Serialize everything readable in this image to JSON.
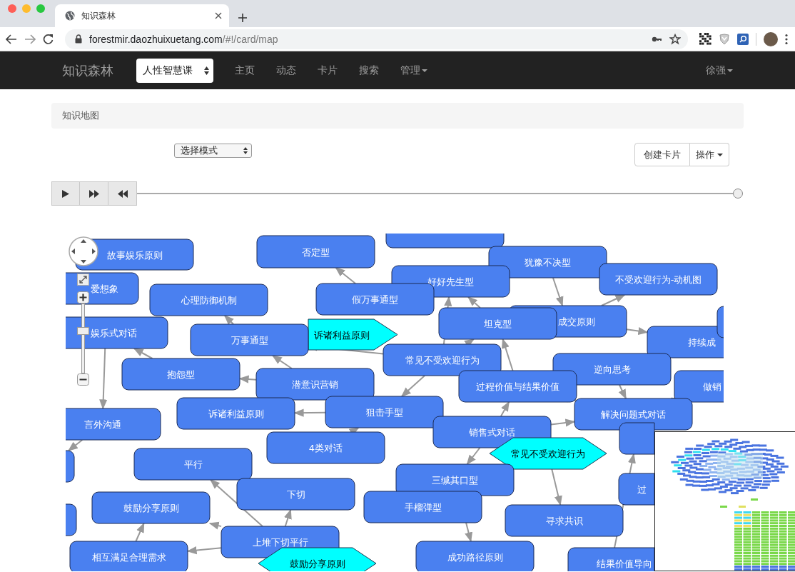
{
  "browser": {
    "tab": {
      "title": "知识森林"
    },
    "url": {
      "host": "forestmir.daozhuixuetang.com",
      "path": "/#!/card/map"
    }
  },
  "navbar": {
    "brand": "知识森林",
    "course_select": {
      "value": "人性智慧课"
    },
    "links": [
      {
        "label": "主页",
        "dropdown": false
      },
      {
        "label": "动态",
        "dropdown": false
      },
      {
        "label": "卡片",
        "dropdown": false
      },
      {
        "label": "搜索",
        "dropdown": false
      },
      {
        "label": "管理",
        "dropdown": true
      }
    ],
    "user": {
      "label": "徐强",
      "dropdown": true
    }
  },
  "breadcrumb": "知识地图",
  "mode_select": {
    "value": "选择模式"
  },
  "buttons": [
    {
      "label": "创建卡片",
      "dropdown": false
    },
    {
      "label": "操作",
      "dropdown": true
    }
  ],
  "timeline": {
    "level": 1
  },
  "map": {
    "zoom": {
      "level": 0.6
    },
    "nodes": [
      {
        "kind": "box",
        "label": "故事娱乐原则"
      },
      {
        "kind": "box",
        "label": "爱想象"
      },
      {
        "kind": "box",
        "label": "否定型"
      },
      {
        "kind": "box"
      },
      {
        "kind": "box",
        "label": "犹豫不决型"
      },
      {
        "kind": "box",
        "label": "好好先生型"
      },
      {
        "kind": "box",
        "label": "不受欢迎行为-动机图"
      },
      {
        "kind": "box",
        "label": "心理防御机制"
      },
      {
        "kind": "box",
        "label": "假万事通型"
      },
      {
        "kind": "box",
        "label": "成交原则"
      },
      {
        "kind": "box",
        "label": "坦克型"
      },
      {
        "kind": "box",
        "label": "娱乐式对话"
      },
      {
        "kind": "hexagon",
        "label": "诉诸利益原则"
      },
      {
        "kind": "box",
        "label": "万事通型"
      },
      {
        "kind": "box",
        "label": "持续成"
      },
      {
        "kind": "box"
      },
      {
        "kind": "box",
        "label": "常见不受欢迎行为"
      },
      {
        "kind": "box",
        "label": "抱怨型"
      },
      {
        "kind": "box",
        "label": "逆向思考"
      },
      {
        "kind": "box",
        "label": "潜意识营销"
      },
      {
        "kind": "box",
        "label": "过程价值与结果价值"
      },
      {
        "kind": "box",
        "label": "做销"
      },
      {
        "kind": "box",
        "label": "诉诸利益原则"
      },
      {
        "kind": "box",
        "label": "狙击手型"
      },
      {
        "kind": "box",
        "label": "解决问题式对话"
      },
      {
        "kind": "box",
        "label": "言外沟通"
      },
      {
        "kind": "box",
        "label": "销售式对话"
      },
      {
        "kind": "box",
        "label": "4类对话"
      },
      {
        "kind": "box"
      },
      {
        "kind": "hexagon",
        "label": "常见不受欢迎行为"
      },
      {
        "kind": "box"
      },
      {
        "kind": "box",
        "label": "平行"
      },
      {
        "kind": "box",
        "label": "三缄其口型"
      },
      {
        "kind": "box",
        "label": "下切"
      },
      {
        "kind": "box",
        "label": "过"
      },
      {
        "kind": "box",
        "label": "手榴弹型"
      },
      {
        "kind": "box",
        "label": "鼓励分享原则"
      },
      {
        "kind": "box"
      },
      {
        "kind": "box",
        "label": "寻求共识"
      },
      {
        "kind": "box",
        "label": "上堆下切平行"
      },
      {
        "kind": "box",
        "label": "相互满足合理需求"
      },
      {
        "kind": "box",
        "label": "成功路径原则"
      },
      {
        "kind": "hexagon",
        "label": "鼓励分享原则"
      },
      {
        "kind": "box",
        "label": "结果价值导向"
      }
    ]
  }
}
